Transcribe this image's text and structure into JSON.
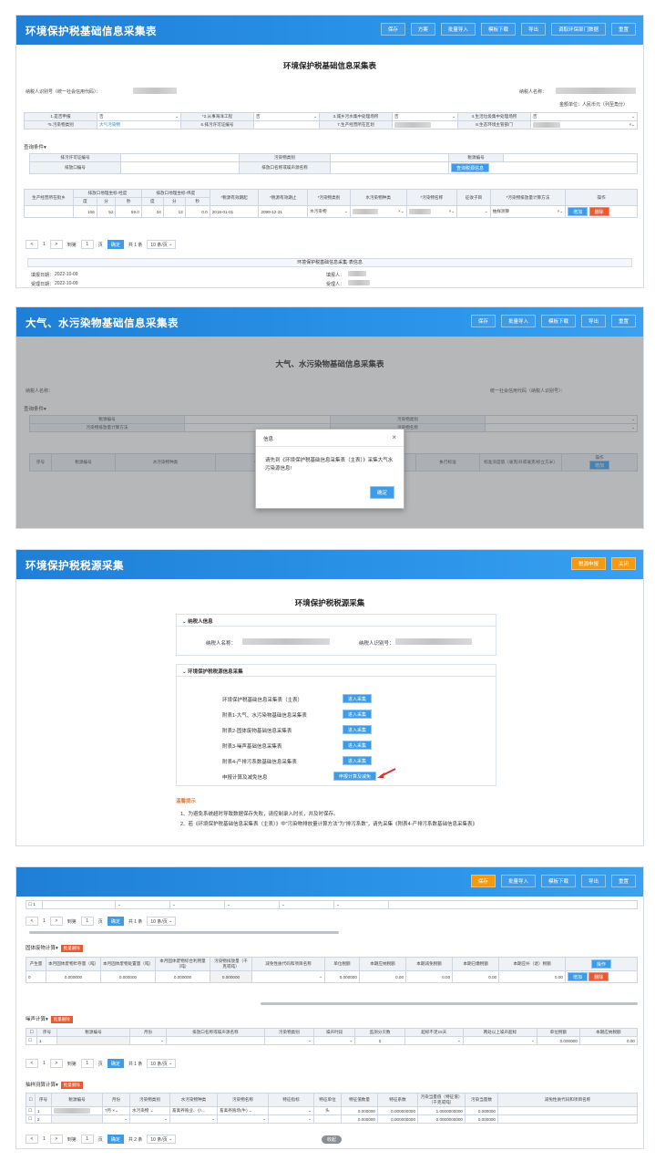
{
  "panel1": {
    "header_title": "环境保护税基础信息采集表",
    "buttons": [
      "保存",
      "方案",
      "批量导入",
      "模板下载",
      "导出",
      "调取环保部门数据",
      "重置"
    ],
    "form_title": "环境保护税基础信息采集表",
    "taxpayer_id_label": "纳税人识别号（统一社会信用代码）：",
    "taxpayer_name_label": "纳税人名称：",
    "unit_label": "金额单位：人民币元（列至角分）",
    "fields": [
      {
        "label": "1.是否申报",
        "value": "否"
      },
      {
        "label": "*2.从事海洋工程",
        "value": "否"
      },
      {
        "label": "3.城乡污水集中处理场所",
        "value": "否"
      },
      {
        "label": "4.生活垃圾集中处理场所",
        "value": "否"
      },
      {
        "label": "*5.污染物类别",
        "value": "大气污染物"
      },
      {
        "label": "6.排污许可证编号",
        "value": ""
      },
      {
        "label": "7.生产经营所在区划",
        "value": ""
      },
      {
        "label": "8.生态环境主管部门",
        "value": ""
      }
    ],
    "query_title": "查询条件",
    "query_fields": [
      "排污许可证编号",
      "污染物类别",
      "税源编号",
      "排放口编号",
      "排放口名称或噪声源名称"
    ],
    "query_button": "查询税源信息",
    "table_headers": [
      "生产经营所在街乡",
      "排放口地理坐标-经度",
      "排放口地理坐标-纬度",
      "*税源有效期起",
      "*税源有效期止",
      "*污染物类别",
      "水污染物种类",
      "*污染物名称",
      "征收子目",
      "*污染物排放量计算方法",
      "操作"
    ],
    "sub_headers": [
      "度",
      "分",
      "秒",
      "度",
      "分",
      "秒"
    ],
    "row": {
      "lon_d": "106",
      "lon_m": "52",
      "lon_s": "59.0",
      "lat_d": "34",
      "lat_m": "13",
      "lat_s": "0.0",
      "start": "2018-01-01",
      "end": "2099-12-31",
      "category": "水污染物",
      "method": "抽样测算",
      "op1": "增加",
      "op2": "删除"
    },
    "pager": {
      "page": "1",
      "goto_label": "到第",
      "page_unit": "页",
      "confirm": "确定",
      "total": "共 1 条",
      "per_page": "10 条/页"
    },
    "footer_title": "环境保护税基础信息采集·表信息",
    "fill_date_label": "填报日期：",
    "fill_date": "2022-10-09",
    "accept_date_label": "受理日期：",
    "accept_date": "2022-10-09",
    "handler_label": "*经办人员：",
    "filler_label": "填报人：",
    "receiver_label": "受理人：",
    "agent_label": "代理机构代码：",
    "close_label": "收起"
  },
  "panel2": {
    "header_title": "大气、水污染物基础信息采集表",
    "buttons": [
      "保存",
      "批量导入",
      "模板下载",
      "导出",
      "重置"
    ],
    "form_title": "大气、水污染物基础信息采集表",
    "taxpayer_name_label": "纳税人名称：",
    "taxpayer_id_label": "统一社会信用代码（纳税人识别号）：",
    "query_title": "查询条件",
    "query_fields": [
      "税源编号",
      "污染物类别",
      "污染物排放量计算方法",
      "污染物名称"
    ],
    "table_headers": [
      "序号",
      "税源编号",
      "水污染物种类",
      "*污染物名称",
      "污染物排放量计算方法",
      "执行标准",
      "标准浓度值（毫克/升或毫克/标立方米）",
      "操作"
    ],
    "op_label": "增加",
    "modal": {
      "title": "信息",
      "close": "×",
      "message": "请先到《环境保护税基础信息采集表（主表）》采集大气水污染源信息!",
      "confirm": "确定"
    }
  },
  "panel3": {
    "header_title": "环境保护税税源采集",
    "buttons": [
      "税源申报",
      "关闭"
    ],
    "form_title": "环境保护税税源采集",
    "section1_title": "纳税人信息",
    "taxpayer_name_label": "纳税人名称：",
    "taxpayer_id_label": "纳税人识别号：",
    "section2_title": "环境保护税税源信息采集",
    "items": [
      {
        "label": "环境保护税基础信息采集表（主表）",
        "button": "进入采集"
      },
      {
        "label": "附表1-大气、水污染物基础信息采集表",
        "button": "进入采集"
      },
      {
        "label": "附表2-固体废物基础信息采集表",
        "button": "进入采集"
      },
      {
        "label": "附表3-噪声基础信息采集表",
        "button": "进入采集"
      },
      {
        "label": "附表4-产排污系数基础信息采集表",
        "button": "进入采集"
      },
      {
        "label": "申报计算及减免信息",
        "button": "申报计算及减免"
      }
    ],
    "hint_title": "温馨提示",
    "hints": [
      "1、为避免系统超时导致数据保存失败，请控制录入时长，并及时保存。",
      "2、若《环境保护税基础信息采集表（主表）》中“污染物排放量计算方法”为“排污系数”，请先采集《附表4-产排污系数基础信息采集表》"
    ]
  },
  "panel4": {
    "buttons": [
      "保存",
      "批量导入",
      "模板下载",
      "导出",
      "重置"
    ],
    "pager_top": {
      "page": "1",
      "goto_label": "到第",
      "page_unit": "页",
      "confirm": "确定",
      "total": "共 1 条",
      "per_page": "10 条/页"
    },
    "solid_title": "固体废物计算",
    "solid_tag": "批量删除",
    "solid_headers": [
      "产生量",
      "本月固体废物贮存量（吨）",
      "本月固体废物处置量（吨）",
      "本月固体废物综合利用量（吨）",
      "污染物排放量（千克或吨）",
      "减免性质代码和项目名称",
      "单位税额",
      "本期应纳税额",
      "本期减免税额",
      "本期已缴税额",
      "本期应补（退）税额",
      "操作"
    ],
    "solid_row": [
      "0",
      "0.000000",
      "0.000000",
      "0.000000",
      "0.000000",
      "",
      "0.000000",
      "0.00",
      "0.00",
      "0.00",
      "0.00"
    ],
    "solid_ops": [
      "增加",
      "删除"
    ],
    "noise_title": "噪声计算",
    "noise_tag": "批量删除",
    "noise_headers": [
      "序号",
      "税源编号",
      "月份",
      "排放口名称或噪声源名称",
      "污染物类别",
      "噪声时段",
      "监测分贝数",
      "超标不足15天",
      "两处以上噪声超标",
      "单位税额",
      "本期应纳税额"
    ],
    "noise_row": [
      "1",
      "",
      "",
      "",
      "",
      "",
      "0",
      "",
      "",
      "0.000000",
      "0.00"
    ],
    "pager_mid": {
      "page": "1",
      "goto_label": "到第",
      "page_unit": "页",
      "confirm": "确定",
      "total": "共 1 条",
      "per_page": "10 条/页"
    },
    "sample_title": "抽样测算计算",
    "sample_tag": "批量删除",
    "sample_headers": [
      "序号",
      "税源编号",
      "月份",
      "污染物类别",
      "水污染物种类",
      "污染物名称",
      "特征指标",
      "特征单位",
      "特征值数量",
      "特征系数",
      "污染当量值（特征值）（千克或吨）",
      "污染当量数",
      "减免性质代码和项目名称"
    ],
    "sample_rows": [
      [
        "1",
        "",
        "7月",
        "水污染物",
        "畜禽养殖业、小...",
        "畜禽养殖场(牛)",
        "",
        "头",
        "0.000000",
        "0.000000000",
        "1.0000000000",
        "0.000000"
      ],
      [
        "2",
        "",
        "",
        "",
        "",
        "",
        "",
        "",
        "0.000000",
        "0.000000000",
        "0.0000000000",
        "0.000000"
      ]
    ],
    "pager_bottom": {
      "page": "1",
      "goto_label": "到第",
      "page_unit": "页",
      "confirm": "确定",
      "total": "共 2 条",
      "per_page": "10 条/页"
    },
    "close_label": "收起"
  }
}
